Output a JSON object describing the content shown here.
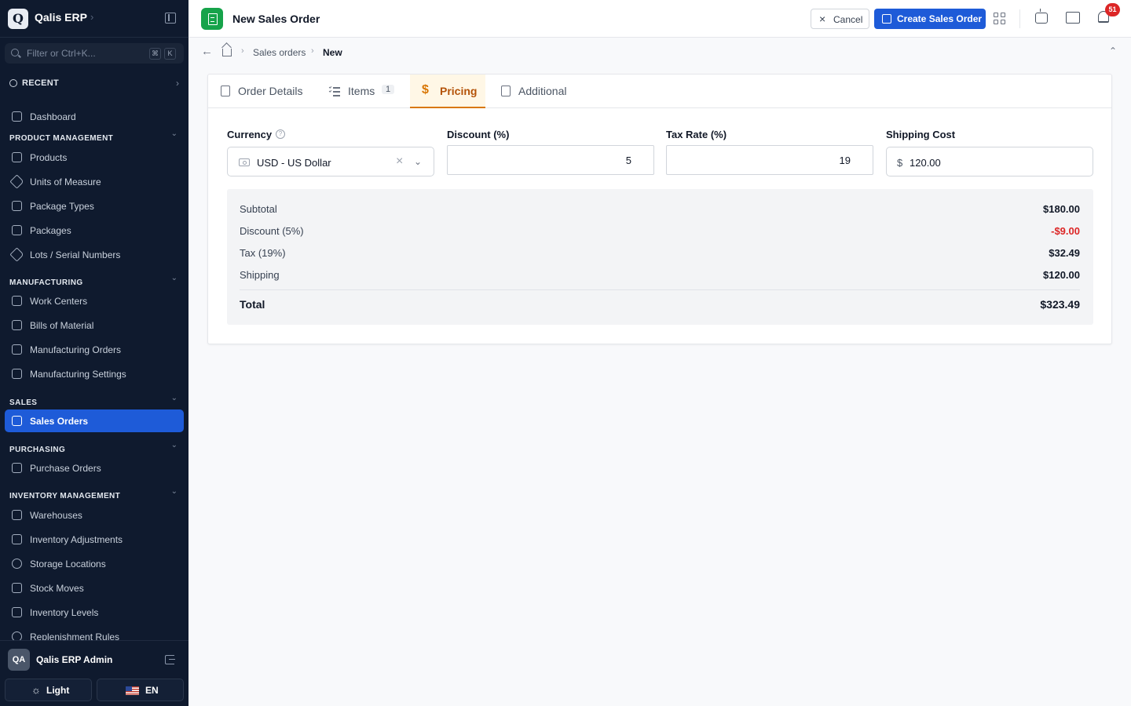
{
  "app": {
    "logo_letter": "Q",
    "name": "Qalis ERP"
  },
  "sidebar": {
    "search_placeholder": "Filter or Ctrl+K...",
    "search_keys": [
      "⌘",
      "K"
    ],
    "recent_label": "RECENT",
    "dashboard": "Dashboard",
    "sections": {
      "product": {
        "title": "PRODUCT MANAGEMENT",
        "items": [
          "Products",
          "Units of Measure",
          "Package Types",
          "Packages",
          "Lots / Serial Numbers"
        ]
      },
      "manufacturing": {
        "title": "MANUFACTURING",
        "items": [
          "Work Centers",
          "Bills of Material",
          "Manufacturing Orders",
          "Manufacturing Settings"
        ]
      },
      "sales": {
        "title": "SALES",
        "items": [
          "Sales Orders"
        ]
      },
      "purchasing": {
        "title": "PURCHASING",
        "items": [
          "Purchase Orders"
        ]
      },
      "inventory": {
        "title": "INVENTORY MANAGEMENT",
        "items": [
          "Warehouses",
          "Inventory Adjustments",
          "Storage Locations",
          "Stock Moves",
          "Inventory Levels",
          "Replenishment Rules"
        ]
      }
    },
    "active_item": "Sales Orders",
    "user": {
      "initials": "QA",
      "name": "Qalis ERP Admin"
    },
    "theme_label": "Light",
    "lang_label": "EN"
  },
  "topbar": {
    "title": "New Sales Order",
    "cancel_label": "Cancel",
    "create_label": "Create Sales Order",
    "notification_count": "51"
  },
  "breadcrumb": {
    "parent": "Sales orders",
    "current": "New"
  },
  "tabs": [
    {
      "label": "Order Details"
    },
    {
      "label": "Items",
      "count": "1"
    },
    {
      "label": "Pricing"
    },
    {
      "label": "Additional"
    }
  ],
  "active_tab": "Pricing",
  "form": {
    "currency": {
      "label": "Currency",
      "value": "USD - US Dollar"
    },
    "discount": {
      "label": "Discount (%)",
      "value": "5"
    },
    "tax_rate": {
      "label": "Tax Rate (%)",
      "value": "19"
    },
    "shipping_cost": {
      "label": "Shipping Cost",
      "currency_symbol": "$",
      "value": "120.00"
    }
  },
  "summary": {
    "subtotal": {
      "label": "Subtotal",
      "value": "$180.00"
    },
    "discount": {
      "label": "Discount (5%)",
      "value": "-$9.00"
    },
    "tax": {
      "label": "Tax (19%)",
      "value": "$32.49"
    },
    "shipping": {
      "label": "Shipping",
      "value": "$120.00"
    },
    "total": {
      "label": "Total",
      "value": "$323.49"
    }
  },
  "colors": {
    "sidebar_bg": "#0f1a2e",
    "accent_blue": "#1e5bd8",
    "active_tab": "#d97706",
    "negative": "#dc2626",
    "doc_badge": "#16a34a"
  }
}
